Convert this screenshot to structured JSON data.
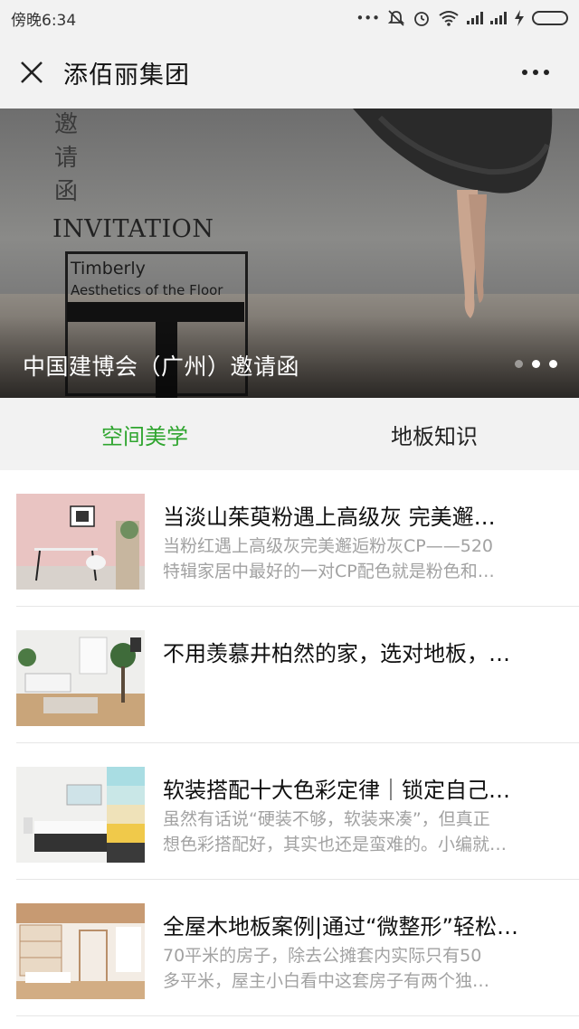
{
  "status_bar": {
    "time": "傍晚6:34",
    "colors": {
      "battery": "#38b83a"
    }
  },
  "header": {
    "title": "添佰丽集团"
  },
  "banner": {
    "vertical_text": [
      "邀",
      "请",
      "函"
    ],
    "invitation": "INVITATION",
    "brand": "Timberly",
    "tagline": "Aesthetics of the Floor",
    "caption": "中国建博会（广州）邀请函",
    "slide_count": 3,
    "active_slide": 2
  },
  "tabs": [
    {
      "label": "空间美学",
      "active": true
    },
    {
      "label": "地板知识",
      "active": false
    }
  ],
  "articles": [
    {
      "title": "当淡山茱萸粉遇上高级灰 完美邂…",
      "desc1": "当粉红遇上高级灰完美邂逅粉灰CP——520",
      "desc2": "特辑家居中最好的一对CP配色就是粉色和…"
    },
    {
      "title": "不用羡慕井柏然的家，选对地板，…",
      "desc1": "",
      "desc2": ""
    },
    {
      "title": "软装搭配十大色彩定律｜锁定自己…",
      "desc1": "虽然有话说“硬装不够，软装来凑”，但真正",
      "desc2": "想色彩搭配好，其实也还是蛮难的。小编就…"
    },
    {
      "title": "全屋木地板案例|通过“微整形”轻松…",
      "desc1": "70平米的房子，除去公摊套内实际只有50",
      "desc2": "多平米，屋主小白看中这套房子有两个独…"
    }
  ],
  "theme": {
    "accent": "#2fa52f",
    "background": "#f2f2f2"
  }
}
